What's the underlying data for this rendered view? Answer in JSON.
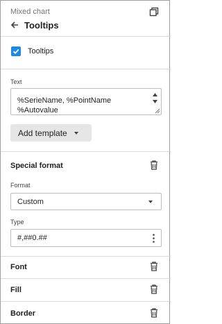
{
  "header": {
    "subtitle": "Mixed chart",
    "title": "Tooltips",
    "restore_icon": "restore-window-icon",
    "back_icon": "arrow-left-icon"
  },
  "tooltips_toggle": {
    "label": "Tooltips",
    "checked": true,
    "accent": "#1e88e5"
  },
  "text_field": {
    "label": "Text",
    "value": "%SerieName, %PointName\n%Autovalue"
  },
  "add_template": {
    "label": "Add template"
  },
  "special_format": {
    "title": "Special format",
    "format": {
      "label": "Format",
      "selected": "Custom"
    },
    "type": {
      "label": "Type",
      "value": "#,##0.##"
    }
  },
  "sections": {
    "font": "Font",
    "fill": "Fill",
    "border": "Border"
  }
}
